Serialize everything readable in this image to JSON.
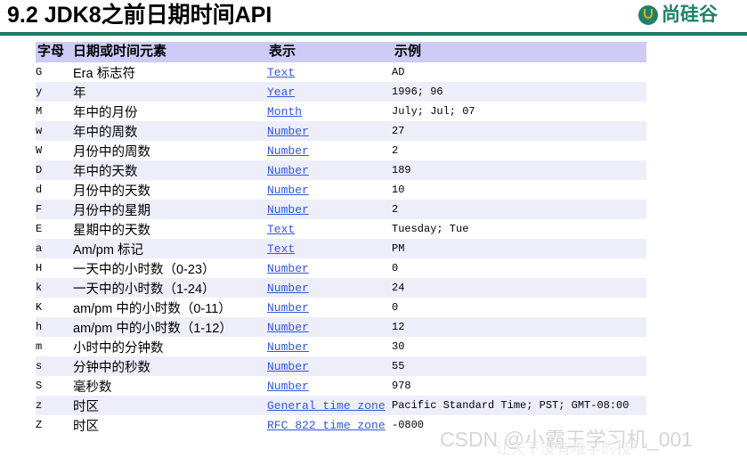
{
  "header": {
    "title": "9.2 JDK8之前日期时间API",
    "rule_color": "#1c8268",
    "logo": {
      "mark_name": "shangsilicon-logo-icon",
      "brand_text": "尚硅谷",
      "brand_color": "#1c8268",
      "accent_color": "#f4a81d"
    }
  },
  "table": {
    "header_bg": "#ccccf7",
    "stripe_bg": "#eeeefb",
    "link_color": "#3355dd",
    "columns": [
      "字母",
      "日期或时间元素",
      "表示",
      "示例"
    ],
    "rows": [
      {
        "letter": "G",
        "element": "Era 标志符",
        "present": "Text",
        "example": "AD"
      },
      {
        "letter": "y",
        "element": "年",
        "present": "Year",
        "example": "1996; 96"
      },
      {
        "letter": "M",
        "element": "年中的月份",
        "present": "Month",
        "example": "July; Jul; 07"
      },
      {
        "letter": "w",
        "element": "年中的周数",
        "present": "Number",
        "example": "27"
      },
      {
        "letter": "W",
        "element": "月份中的周数",
        "present": "Number",
        "example": "2"
      },
      {
        "letter": "D",
        "element": "年中的天数",
        "present": "Number",
        "example": "189"
      },
      {
        "letter": "d",
        "element": "月份中的天数",
        "present": "Number",
        "example": "10"
      },
      {
        "letter": "F",
        "element": "月份中的星期",
        "present": "Number",
        "example": "2"
      },
      {
        "letter": "E",
        "element": "星期中的天数",
        "present": "Text",
        "example": "Tuesday; Tue"
      },
      {
        "letter": "a",
        "element": "Am/pm 标记",
        "present": "Text",
        "example": "PM"
      },
      {
        "letter": "H",
        "element": "一天中的小时数（0-23）",
        "present": "Number",
        "example": "0"
      },
      {
        "letter": "k",
        "element": "一天中的小时数（1-24）",
        "present": "Number",
        "example": "24"
      },
      {
        "letter": "K",
        "element": "am/pm 中的小时数（0-11）",
        "present": "Number",
        "example": "0"
      },
      {
        "letter": "h",
        "element": "am/pm 中的小时数（1-12）",
        "present": "Number",
        "example": "12"
      },
      {
        "letter": "m",
        "element": "小时中的分钟数",
        "present": "Number",
        "example": "30"
      },
      {
        "letter": "s",
        "element": "分钟中的秒数",
        "present": "Number",
        "example": "55"
      },
      {
        "letter": "S",
        "element": "毫秒数",
        "present": "Number",
        "example": "978"
      },
      {
        "letter": "z",
        "element": "时区",
        "present": "General time zone",
        "example": "Pacific Standard Time; PST; GMT-08:00"
      },
      {
        "letter": "Z",
        "element": "时区",
        "present": "RFC 822 time zone",
        "example": "-0800"
      }
    ]
  },
  "watermarks": {
    "csdn": "CSDN @小霸王学习机_001",
    "background": "让天下没有难学的技"
  }
}
